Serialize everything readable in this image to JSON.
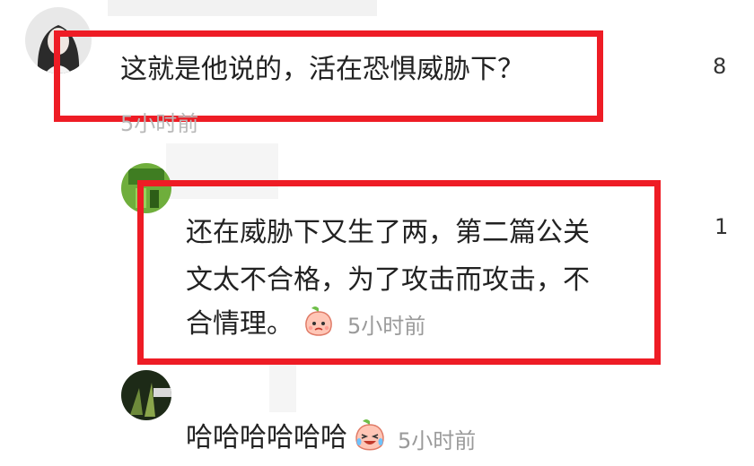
{
  "comments": [
    {
      "text": "这就是他说的，活在恐惧威胁下？",
      "time": "5小时前",
      "like_count": "8",
      "avatar_icon": "user-avatar-woman-icon"
    },
    {
      "lines": [
        "还在威胁下又生了两，第二篇公关",
        "文太不合格，为了攻击而攻击，不",
        "合情理。"
      ],
      "time": "5小时前",
      "like_count": "1",
      "emoji_icon": "peach-face-emoji-icon",
      "avatar_icon": "user-avatar-green-icon"
    },
    {
      "text": "哈哈哈哈哈哈",
      "time": "5小时前",
      "emoji_icon": "peach-crying-laugh-emoji-icon",
      "avatar_icon": "user-avatar-dark-icon"
    }
  ],
  "colors": {
    "highlight_border": "#ee1c25",
    "meta_text": "#9a9a9a",
    "body_text": "#222222"
  }
}
